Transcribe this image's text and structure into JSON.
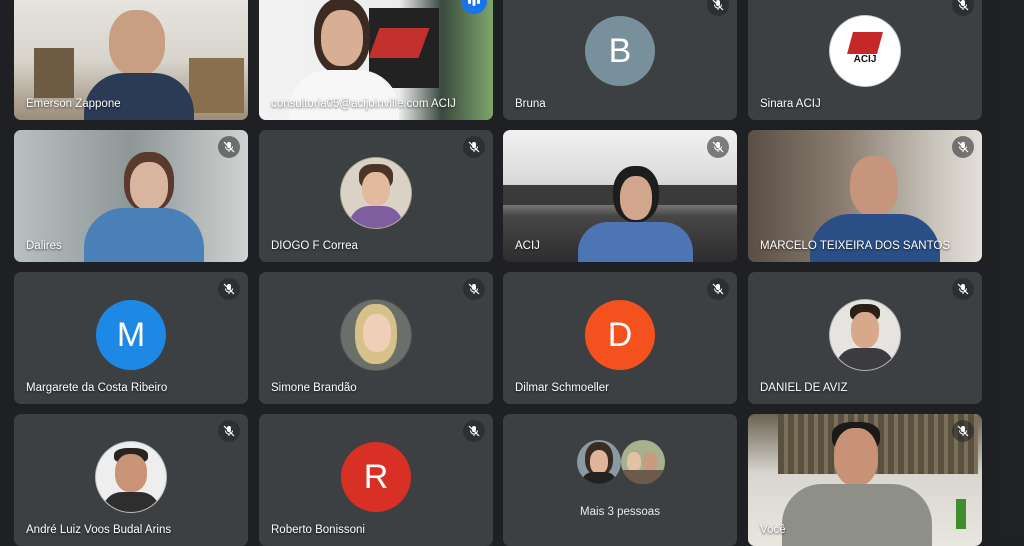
{
  "participants": [
    {
      "name": "Emerson Zappone",
      "muted": false,
      "type": "video"
    },
    {
      "name": "consultoria05@acijoinville.com ACIJ",
      "muted": false,
      "type": "video",
      "speaking": true
    },
    {
      "name": "Bruna",
      "muted": true,
      "type": "letter",
      "letter": "B",
      "color": "#78909c"
    },
    {
      "name": "Sinara ACIJ",
      "muted": true,
      "type": "logo",
      "logo_text": "ACIJ"
    },
    {
      "name": "Dalires",
      "muted": true,
      "type": "video"
    },
    {
      "name": "DIOGO F Correa",
      "muted": true,
      "type": "photo"
    },
    {
      "name": "ACIJ",
      "muted": true,
      "type": "video"
    },
    {
      "name": "MARCELO TEIXEIRA DOS SANTOS",
      "muted": true,
      "type": "video"
    },
    {
      "name": "Margarete da Costa Ribeiro",
      "muted": true,
      "type": "letter",
      "letter": "M",
      "color": "#1e88e5"
    },
    {
      "name": "Simone Brandão",
      "muted": true,
      "type": "photo"
    },
    {
      "name": "Dilmar Schmoeller",
      "muted": true,
      "type": "letter",
      "letter": "D",
      "color": "#f4511e"
    },
    {
      "name": "DANIEL DE AVIZ",
      "muted": true,
      "type": "photo"
    },
    {
      "name": "André Luiz Voos Budal Arins",
      "muted": true,
      "type": "photo"
    },
    {
      "name": "Roberto Bonissoni",
      "muted": true,
      "type": "letter",
      "letter": "R",
      "color": "#d93025"
    },
    {
      "name": "Mais 3 pessoas",
      "muted": false,
      "type": "more"
    },
    {
      "name": "Você",
      "muted": true,
      "type": "video"
    }
  ],
  "colors": {
    "tile_bg": "#3c4043",
    "page_bg": "#1f2023",
    "speaking_outline": "#8ab4f8"
  }
}
